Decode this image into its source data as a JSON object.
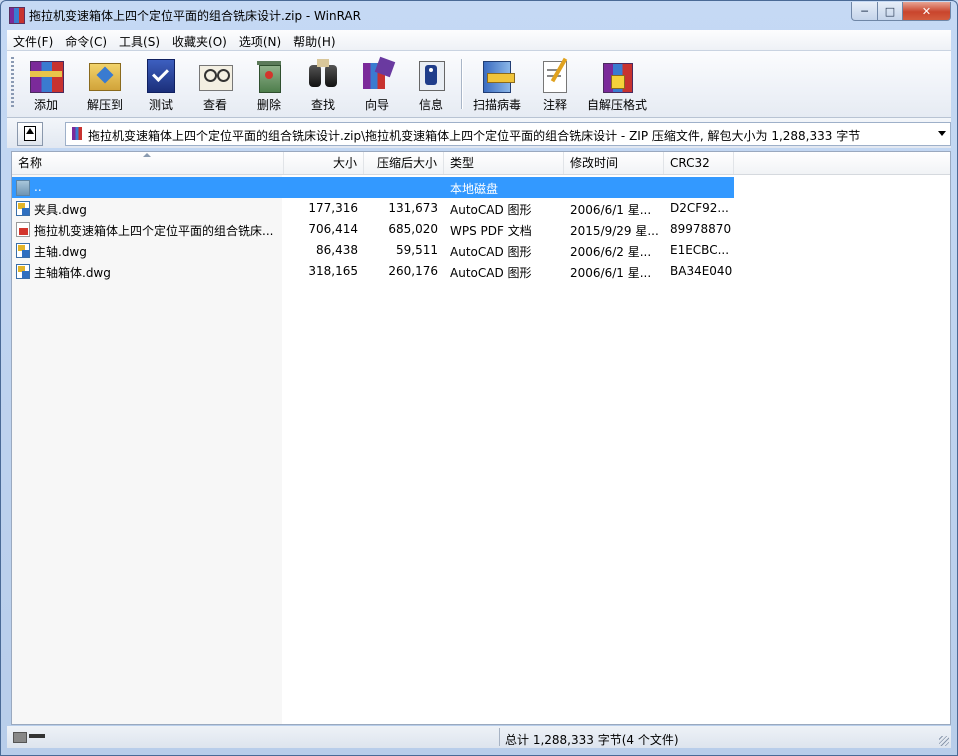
{
  "window": {
    "title": "拖拉机变速箱体上四个定位平面的组合铣床设计.zip - WinRAR",
    "min_glyph": "─",
    "max_glyph": "□",
    "close_glyph": "✕"
  },
  "menu": [
    "文件(F)",
    "命令(C)",
    "工具(S)",
    "收藏夹(O)",
    "选项(N)",
    "帮助(H)"
  ],
  "toolbar": [
    {
      "label": "添加",
      "icon": "add-archive-icon"
    },
    {
      "label": "解压到",
      "icon": "extract-to-icon"
    },
    {
      "label": "测试",
      "icon": "test-icon"
    },
    {
      "label": "查看",
      "icon": "view-icon"
    },
    {
      "label": "删除",
      "icon": "delete-icon"
    },
    {
      "label": "查找",
      "icon": "find-icon"
    },
    {
      "label": "向导",
      "icon": "wizard-icon"
    },
    {
      "label": "信息",
      "icon": "info-icon"
    },
    {
      "label": "扫描病毒",
      "icon": "scan-virus-icon"
    },
    {
      "label": "注释",
      "icon": "comment-icon"
    },
    {
      "label": "自解压格式",
      "icon": "sfx-icon"
    }
  ],
  "address": {
    "path": "拖拉机变速箱体上四个定位平面的组合铣床设计.zip\\拖拉机变速箱体上四个定位平面的组合铣床设计 - ZIP 压缩文件, 解包大小为 1,288,333 字节"
  },
  "columns": {
    "name": "名称",
    "size": "大小",
    "packed": "压缩后大小",
    "type": "类型",
    "modified": "修改时间",
    "crc": "CRC32"
  },
  "rows": [
    {
      "name": "..",
      "size": "",
      "packed": "",
      "type": "本地磁盘",
      "modified": "",
      "crc": "",
      "icon": "folder-up-icon",
      "selected": true
    },
    {
      "name": "夹具.dwg",
      "size": "177,316",
      "packed": "131,673",
      "type": "AutoCAD 图形",
      "modified": "2006/6/1 星...",
      "crc": "D2CF92...",
      "icon": "dwg-file-icon"
    },
    {
      "name": "拖拉机变速箱体上四个定位平面的组合铣床...",
      "size": "706,414",
      "packed": "685,020",
      "type": "WPS PDF 文档",
      "modified": "2015/9/29 星...",
      "crc": "89978870",
      "icon": "pdf-file-icon"
    },
    {
      "name": "主轴.dwg",
      "size": "86,438",
      "packed": "59,511",
      "type": "AutoCAD 图形",
      "modified": "2006/6/2 星...",
      "crc": "E1ECBC...",
      "icon": "dwg-file-icon"
    },
    {
      "name": "主轴箱体.dwg",
      "size": "318,165",
      "packed": "260,176",
      "type": "AutoCAD 图形",
      "modified": "2006/6/1 星...",
      "crc": "BA34E040",
      "icon": "dwg-file-icon"
    }
  ],
  "status": {
    "summary": "总计 1,288,333 字节(4 个文件)"
  }
}
